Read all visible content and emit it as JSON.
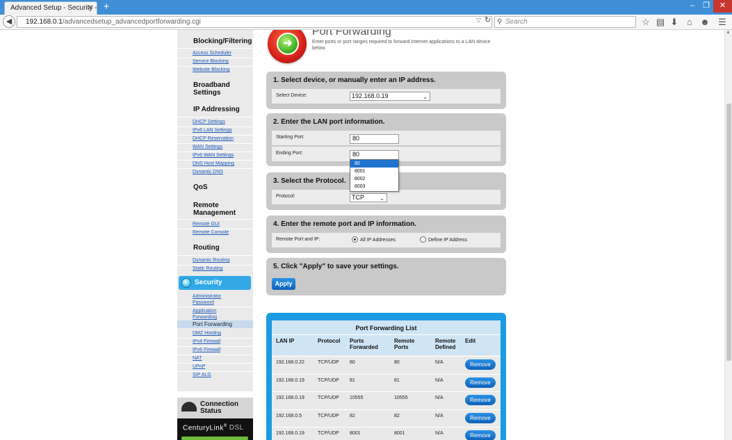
{
  "browser": {
    "tab_title": "Advanced Setup - Security - Ad...",
    "url_host": "192.168.0.1",
    "url_path": "/advancedsetup_advancedportforwarding.cgi",
    "search_placeholder": "Search"
  },
  "sidebar": {
    "blocking_filtering": "Blocking/Filtering",
    "access_scheduler": "Access Scheduler",
    "service_blocking": "Service Blocking",
    "website_blocking": "Website Blocking",
    "broadband_settings_1": "Broadband",
    "broadband_settings_2": "Settings",
    "ip_addressing": "IP Addressing",
    "dhcp_settings": "DHCP Settings",
    "ipv6_lan_settings": "IPv6 LAN Settings",
    "dhcp_reservation": "DHCP Reservation",
    "wan_settings": "WAN Settings",
    "ipv6_wan_settings": "IPv6 WAN Settings",
    "dns_host_mapping": "DNS Host Mapping",
    "dynamic_dns": "Dynamic DNS",
    "qos": "QoS",
    "remote_management_1": "Remote",
    "remote_management_2": "Management",
    "remote_gui": "Remote GUI",
    "remote_console": "Remote Console",
    "routing": "Routing",
    "dynamic_routing": "Dynamic Routing",
    "static_routing": "Static Routing",
    "security": "Security",
    "administrator_password_1": "Administrator",
    "administrator_password_2": "Password",
    "application_forwarding_1": "Application",
    "application_forwarding_2": "Forwarding",
    "port_forwarding": "Port Forwarding",
    "dmz_hosting": "DMZ Hosting",
    "ipv4_firewall": "IPv4 Firewall",
    "ipv6_firewall": "IPv6 Firewall",
    "nat": "NAT",
    "upnp": "UPnP",
    "sip_alg": "SIP ALG"
  },
  "connection": {
    "label_1": "Connection",
    "label_2": "Status",
    "brand": "CenturyLink",
    "brand_mark": "®",
    "brand_dsl": "DSL"
  },
  "header": {
    "title": "Port Forwarding",
    "description": "Enter ports or port ranges required to forward Internet applications to a LAN device below."
  },
  "step1": {
    "title": "1. Select device, or manually enter an IP address.",
    "label": "Select Device:",
    "value": "192.168.0.19"
  },
  "step2": {
    "title": "2. Enter the LAN port information.",
    "start_label": "Starting Port:",
    "start_value": "80",
    "end_label": "Ending Port:",
    "end_value": "80",
    "suggestions": [
      "80",
      "8001",
      "8002",
      "8003"
    ]
  },
  "step3": {
    "title": "3. Select the Protocol.",
    "label": "Protocol:",
    "value": "TCP"
  },
  "step4": {
    "title": "4. Enter the remote port and IP information.",
    "label": "Remote Port and IP:",
    "opt_all": "All IP Addresses",
    "opt_define": "Define IP Address"
  },
  "step5": {
    "title": "5. Click \"Apply\" to save your settings.",
    "apply_label": "Apply"
  },
  "list": {
    "title": "Port Forwarding List",
    "columns": {
      "lan_ip": "LAN IP",
      "protocol": "Protocol",
      "ports_fwd_1": "Ports",
      "ports_fwd_2": "Forwarded",
      "remote_ports_1": "Remote",
      "remote_ports_2": "Ports",
      "remote_def_1": "Remote",
      "remote_def_2": "Defined",
      "edit": "Edit"
    },
    "remove_label": "Remove",
    "rows": [
      {
        "lan_ip": "192.168.0.22",
        "protocol": "TCP/UDP",
        "ports": "80",
        "remote_ports": "80",
        "remote_defined": "N/A"
      },
      {
        "lan_ip": "192.168.0.19",
        "protocol": "TCP/UDP",
        "ports": "81",
        "remote_ports": "81",
        "remote_defined": "N/A"
      },
      {
        "lan_ip": "192.168.0.19",
        "protocol": "TCP/UDP",
        "ports": "10555",
        "remote_ports": "10555",
        "remote_defined": "N/A"
      },
      {
        "lan_ip": "192.168.0.5",
        "protocol": "TCP/UDP",
        "ports": "82",
        "remote_ports": "82",
        "remote_defined": "N/A"
      },
      {
        "lan_ip": "192.168.0.19",
        "protocol": "TCP/UDP",
        "ports": "8001",
        "remote_ports": "8001",
        "remote_defined": "N/A"
      }
    ]
  }
}
